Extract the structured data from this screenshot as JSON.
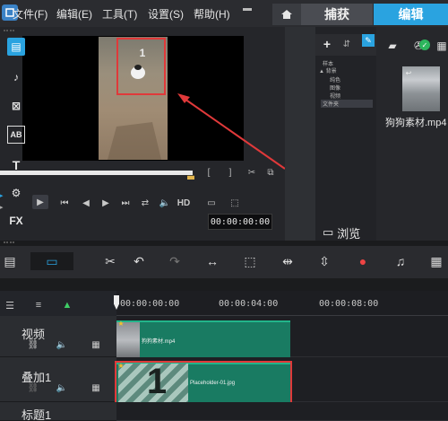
{
  "menu": {
    "file": "文件(F)",
    "edit": "编辑(E)",
    "tools": "工具(T)",
    "settings": "设置(S)",
    "help": "帮助(H)"
  },
  "modes": {
    "home_icon": "home-icon",
    "capture": "捕获",
    "edit": "编辑"
  },
  "player": {
    "frame_number": "1",
    "bracket_in": "[",
    "bracket_out": "]",
    "hd": "HD",
    "timecode": "00:00:00:00",
    "progress": 0.43
  },
  "library": {
    "tree": [
      "样本",
      "▲ 背景",
      "纯色",
      "图像",
      "视频",
      "文件夹"
    ],
    "browse": "浏览",
    "media_item": "狗狗素材.mp4"
  },
  "tool_strip": {
    "title_label": "AB",
    "fx_label": "FX",
    "text_label": "T"
  },
  "timeline": {
    "ticks": [
      "00:00:00:00",
      "00:00:04:00",
      "00:00:08:00"
    ],
    "tracks": [
      {
        "name": "视频",
        "clip": "狗狗素材.mp4"
      },
      {
        "name": "叠加1",
        "clip": "Placeholder-01.jpg",
        "placeholder_number": "1"
      },
      {
        "name": "标题1"
      }
    ]
  },
  "colors": {
    "accent": "#2aa3e0",
    "clip": "#197b62",
    "highlight": "#e0393a"
  }
}
